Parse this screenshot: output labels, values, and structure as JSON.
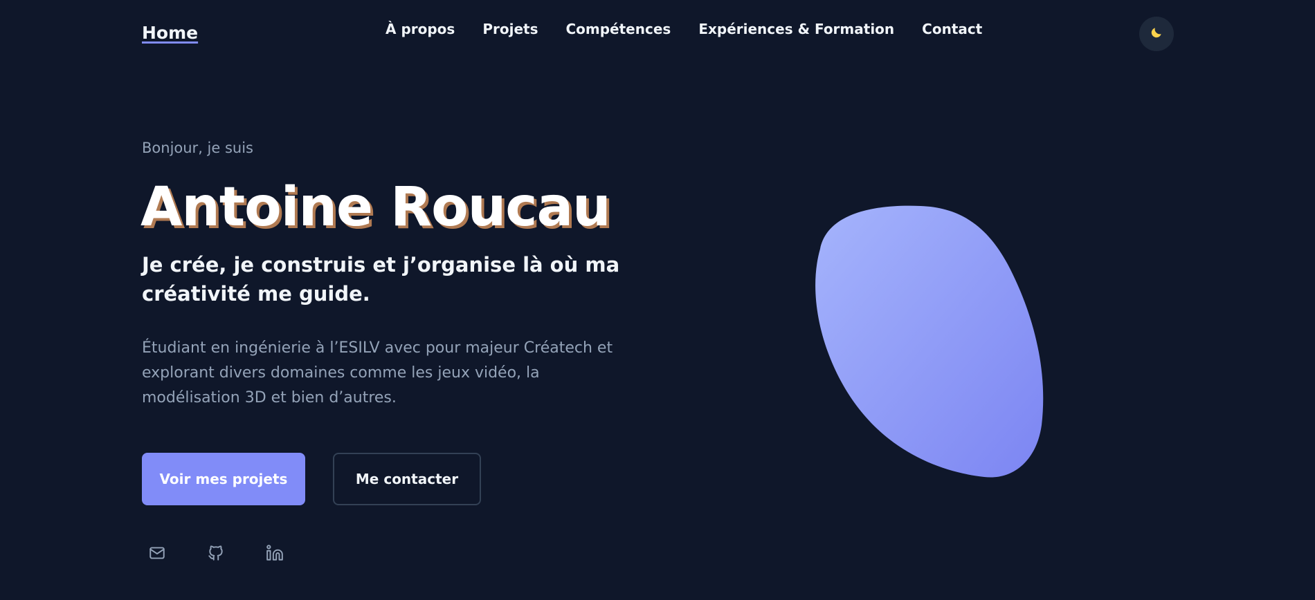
{
  "nav": {
    "brand": "Home",
    "links": [
      {
        "label": "À propos"
      },
      {
        "label": "Projets"
      },
      {
        "label": "Compétences"
      },
      {
        "label": "Expériences & Formation"
      },
      {
        "label": "Contact"
      }
    ],
    "theme_toggle_icon": "moon-icon"
  },
  "hero": {
    "greeting": "Bonjour, je suis",
    "name": "Antoine Roucau",
    "tagline": "Je crée, je construis et j’organise là où ma créativité me guide.",
    "description": "Étudiant en ingénierie à l’ESILV avec pour majeur Créatech et explorant divers domaines comme les jeux vidéo, la modélisation 3D et bien d’autres.",
    "primary_button": "Voir mes projets",
    "secondary_button": "Me contacter",
    "socials": [
      {
        "icon": "mail-icon"
      },
      {
        "icon": "github-icon"
      },
      {
        "icon": "linkedin-icon"
      }
    ]
  },
  "colors": {
    "background": "#0f172a",
    "accent": "#818cf8",
    "text_primary": "#f1f5f9",
    "text_muted": "#94a3b8",
    "name_shadow": "#b07a52"
  }
}
